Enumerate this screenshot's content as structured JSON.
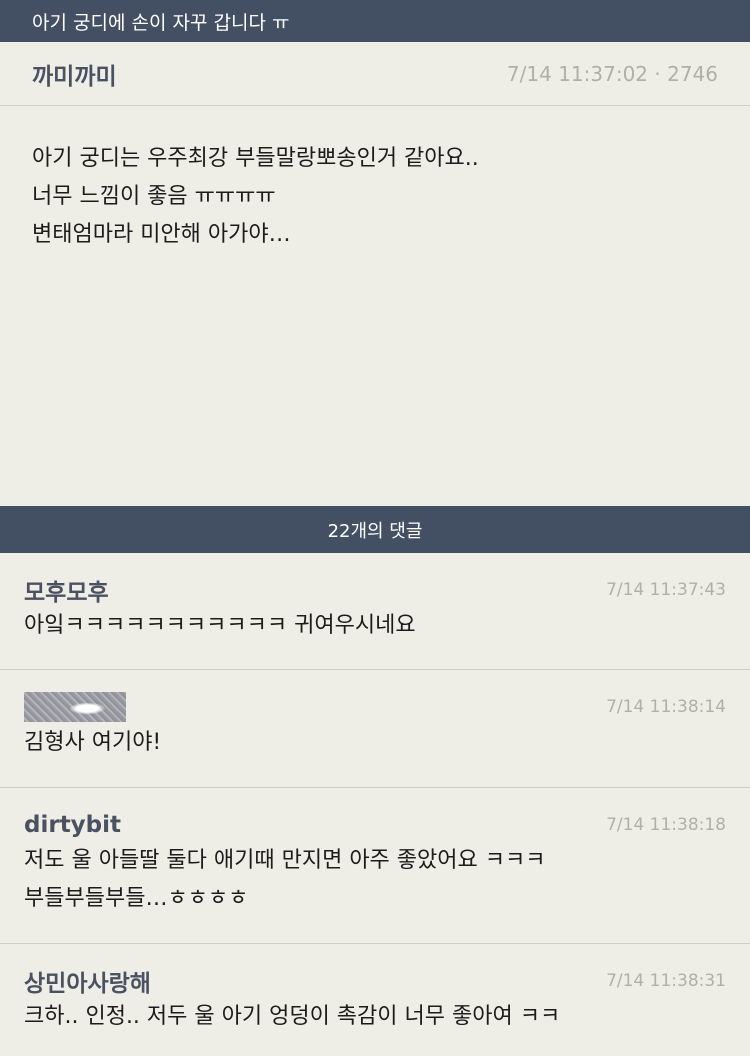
{
  "header": {
    "title": "아기 궁디에 손이 자꾸 갑니다 ㅠ"
  },
  "post": {
    "author": "까미까미",
    "meta": "7/14 11:37:02 · 2746",
    "lines": [
      "아기 궁디는 우주최강 부들말랑뽀송인거 같아요..",
      "너무 느낌이 좋음 ㅠㅠㅠㅠ",
      "변태엄마라 미안해 아가야…"
    ]
  },
  "comments_bar": {
    "label": "22개의 댓글"
  },
  "comments": [
    {
      "author": "모후모후",
      "time": "7/14 11:37:43",
      "lines": [
        "아잌ㅋㅋㅋㅋㅋㅋㅋㅋㅋㅋㅋ 귀여우시네요"
      ]
    },
    {
      "author": "",
      "time": "7/14 11:38:14",
      "lines": [
        "김형사 여기야!"
      ]
    },
    {
      "author": "dirtybit",
      "time": "7/14 11:38:18",
      "lines": [
        "저도 울 아들딸 둘다 애기때 만지면 아주 좋았어요 ㅋㅋㅋ",
        "부들부들부들…ㅎㅎㅎㅎ"
      ]
    },
    {
      "author": "상민아사랑해",
      "time": "7/14 11:38:31",
      "lines": [
        "크하.. 인정.. 저두 울 아기 엉덩이 촉감이 너무 좋아여 ㅋㅋ"
      ]
    }
  ]
}
